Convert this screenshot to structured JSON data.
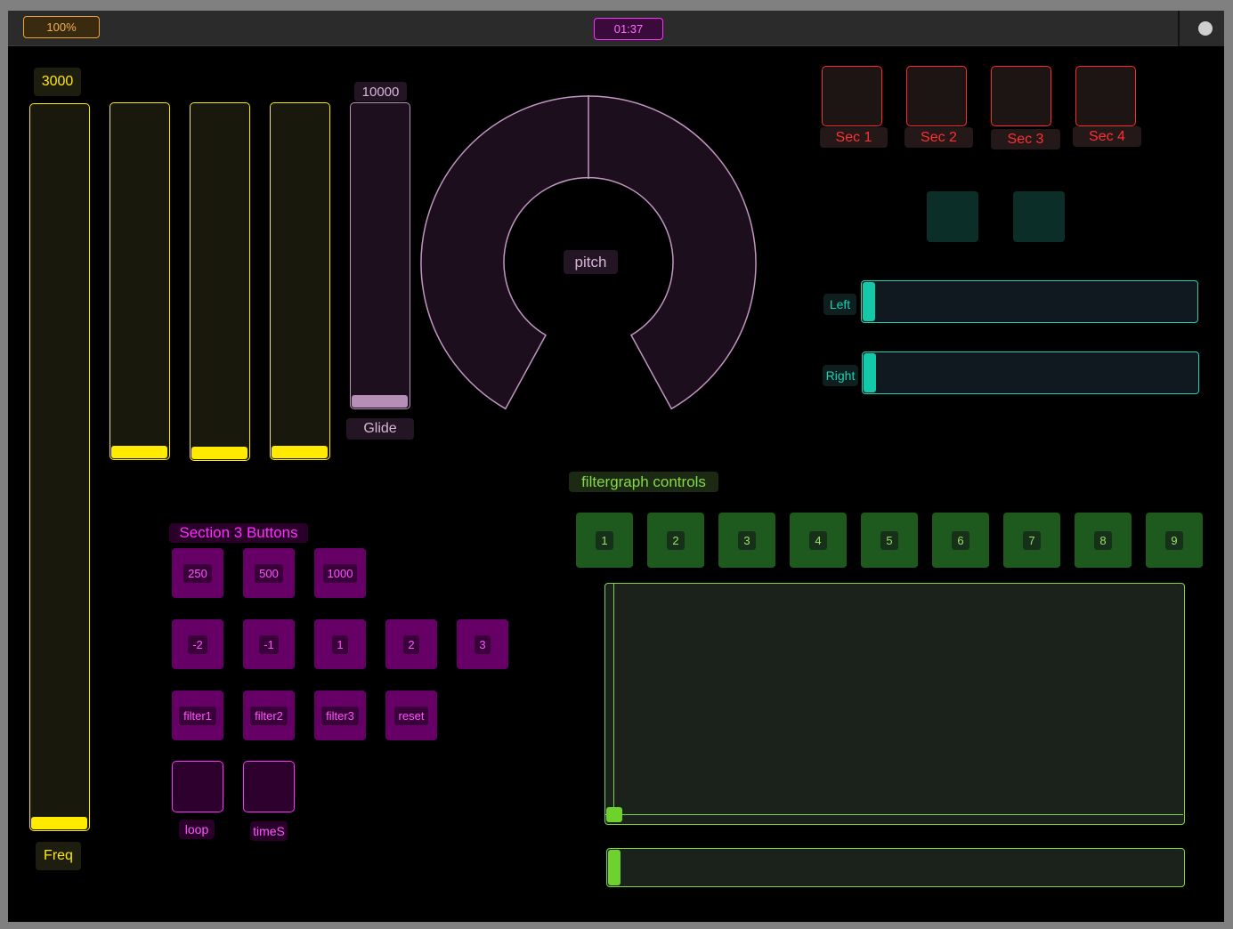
{
  "topbar": {
    "zoom": "100%",
    "timer": "01:37"
  },
  "freq": {
    "value": "3000",
    "label": "Freq"
  },
  "glide": {
    "value": "10000",
    "label": "Glide"
  },
  "pitch": {
    "label": "pitch"
  },
  "sections": [
    {
      "label": "Sec 1"
    },
    {
      "label": "Sec 2"
    },
    {
      "label": "Sec 3"
    },
    {
      "label": "Sec 4"
    }
  ],
  "balance": {
    "left_label": "Left",
    "right_label": "Right"
  },
  "section3": {
    "title": "Section 3 Buttons",
    "row1": [
      "250",
      "500",
      "1000"
    ],
    "row2": [
      "-2",
      "-1",
      "1",
      "2",
      "3"
    ],
    "row3": [
      "filter1",
      "filter2",
      "filter3",
      "reset"
    ],
    "toggles": [
      "loop",
      "timeS"
    ]
  },
  "filtergraph": {
    "title": "filtergraph controls",
    "buttons": [
      "1",
      "2",
      "3",
      "4",
      "5",
      "6",
      "7",
      "8",
      "9"
    ]
  },
  "colors": {
    "yellow": "#ffea00",
    "purple": "#b88fb8",
    "red": "#ff2a2a",
    "teal": "#19d3b4",
    "magenta": "#ff2dff",
    "green": "#7ed636"
  }
}
